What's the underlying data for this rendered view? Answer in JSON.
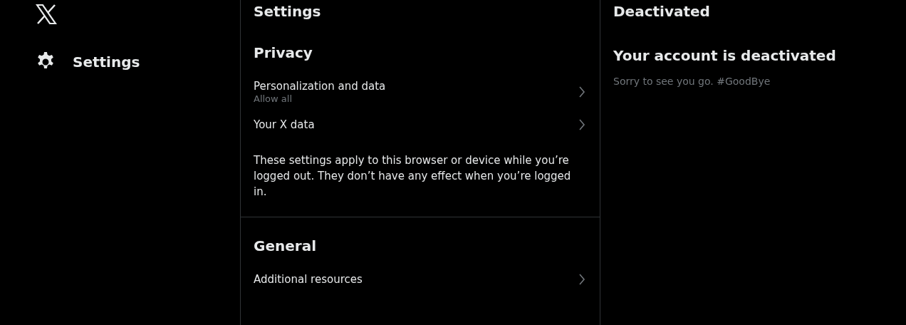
{
  "nav": {
    "items": [
      {
        "label": "Settings",
        "selected": true
      }
    ]
  },
  "settings": {
    "title": "Settings",
    "sections": [
      {
        "title": "Privacy",
        "items": [
          {
            "label": "Personalization and data",
            "sublabel": "Allow all"
          },
          {
            "label": "Your X data"
          }
        ],
        "note": "These settings apply to this browser or device while you’re logged out. They don’t have any effect when you’re logged in."
      },
      {
        "title": "General",
        "items": [
          {
            "label": "Additional resources"
          }
        ]
      }
    ]
  },
  "detail": {
    "title": "Deactivated",
    "heading": "Your account is deactivated",
    "message": "Sorry to see you go. #GoodBye"
  }
}
